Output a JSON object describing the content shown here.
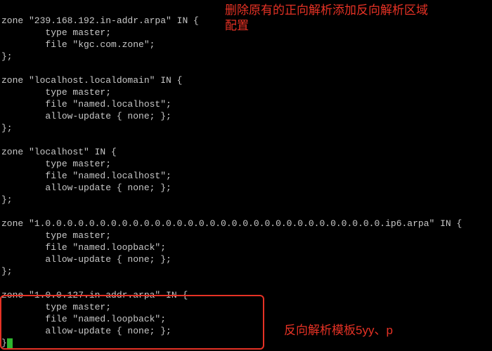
{
  "annotations": {
    "top": "删除原有的正向解析添加反向解析区域配置",
    "bottom": "反向解析模板5yy、p"
  },
  "code": {
    "l01": "zone \"239.168.192.in-addr.arpa\" IN {",
    "l02": "        type master;",
    "l03": "        file \"kgc.com.zone\";",
    "l04": "};",
    "l05": "",
    "l06": "zone \"localhost.localdomain\" IN {",
    "l07": "        type master;",
    "l08": "        file \"named.localhost\";",
    "l09": "        allow-update { none; };",
    "l10": "};",
    "l11": "",
    "l12": "zone \"localhost\" IN {",
    "l13": "        type master;",
    "l14": "        file \"named.localhost\";",
    "l15": "        allow-update { none; };",
    "l16": "};",
    "l17": "",
    "l18": "zone \"1.0.0.0.0.0.0.0.0.0.0.0.0.0.0.0.0.0.0.0.0.0.0.0.0.0.0.0.0.0.0.0.ip6.arpa\" IN {",
    "l19": "        type master;",
    "l20": "        file \"named.loopback\";",
    "l21": "        allow-update { none; };",
    "l22": "};",
    "l23": "",
    "l24": "zone \"1.0.0.127.in-addr.arpa\" IN {",
    "l25": "        type master;",
    "l26": "        file \"named.loopback\";",
    "l27": "        allow-update { none; };",
    "l28": "}"
  }
}
